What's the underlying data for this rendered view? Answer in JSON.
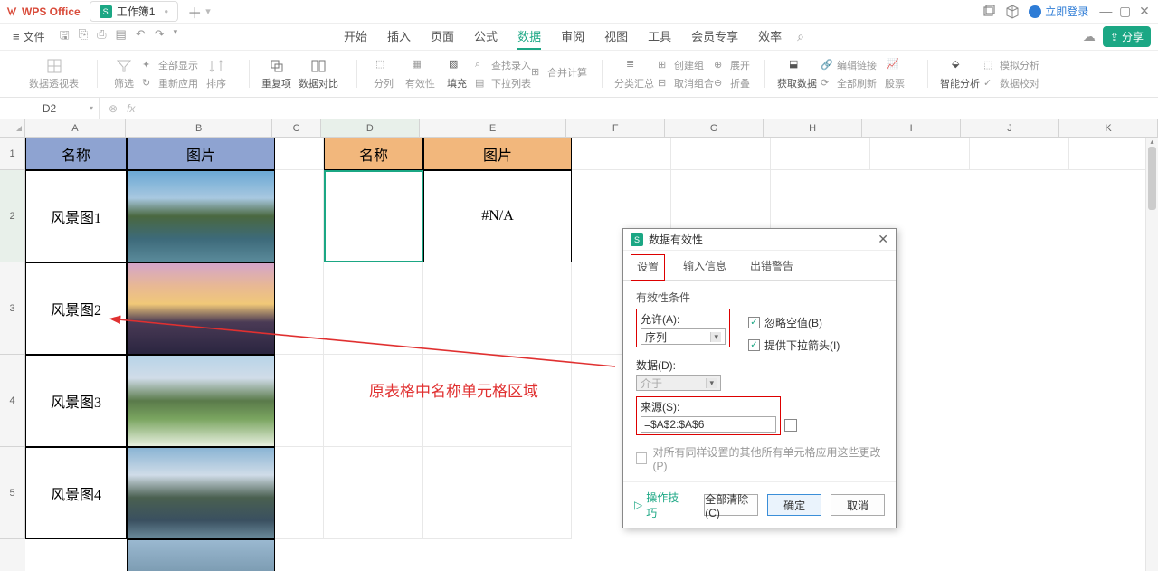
{
  "titlebar": {
    "app_name": "WPS Office",
    "tab_label": "工作簿1",
    "login_label": "立即登录"
  },
  "menubar": {
    "file_label": "文件",
    "tabs": [
      "开始",
      "插入",
      "页面",
      "公式",
      "数据",
      "审阅",
      "视图",
      "工具",
      "会员专享",
      "效率"
    ],
    "active_index": 4,
    "share_label": "分享"
  },
  "ribbon": {
    "pivot": "数据透视表",
    "filter": "筛选",
    "show_all": "全部显示",
    "reapply": "重新应用",
    "sort": "排序",
    "dup": "重复项",
    "compare": "数据对比",
    "split_col": "分列",
    "validity": "有效性",
    "fill": "填充",
    "find_entry": "查找录入",
    "merge_calc": "合并计算",
    "dropdown": "下拉列表",
    "subtotal": "分类汇总",
    "outline_group": "创建组",
    "ungroup": "取消组合",
    "expand": "展开",
    "collapse": "折叠",
    "get_data": "获取数据",
    "edit_link": "编辑链接",
    "refresh_all": "全部刷新",
    "stocks": "股票",
    "smart_analysis": "智能分析",
    "what_if": "模拟分析",
    "data_check": "数据校对"
  },
  "namebox": {
    "value": "D2"
  },
  "columns": [
    "A",
    "B",
    "C",
    "D",
    "E",
    "F",
    "G",
    "H",
    "I",
    "J",
    "K"
  ],
  "rows": [
    "1",
    "2",
    "3",
    "4",
    "5"
  ],
  "sheet": {
    "header_name": "名称",
    "header_image": "图片",
    "header_name2": "名称",
    "header_image2": "图片",
    "a2": "风景图1",
    "a3": "风景图2",
    "a4": "风景图3",
    "a5": "风景图4",
    "e2": "#N/A"
  },
  "annotation": "原表格中名称单元格区域",
  "dialog": {
    "title": "数据有效性",
    "tabs": [
      "设置",
      "输入信息",
      "出错警告"
    ],
    "active_tab": 0,
    "section": "有效性条件",
    "allow_label": "允许(A):",
    "allow_value": "序列",
    "data_label": "数据(D):",
    "data_value": "介于",
    "ignore_blank": "忽略空值(B)",
    "in_cell_dropdown": "提供下拉箭头(I)",
    "source_label": "来源(S):",
    "source_value": "=$A$2:$A$6",
    "apply_all": "对所有同样设置的其他所有单元格应用这些更改(P)",
    "tips": "操作技巧",
    "clear_all": "全部清除(C)",
    "ok": "确定",
    "cancel": "取消"
  }
}
